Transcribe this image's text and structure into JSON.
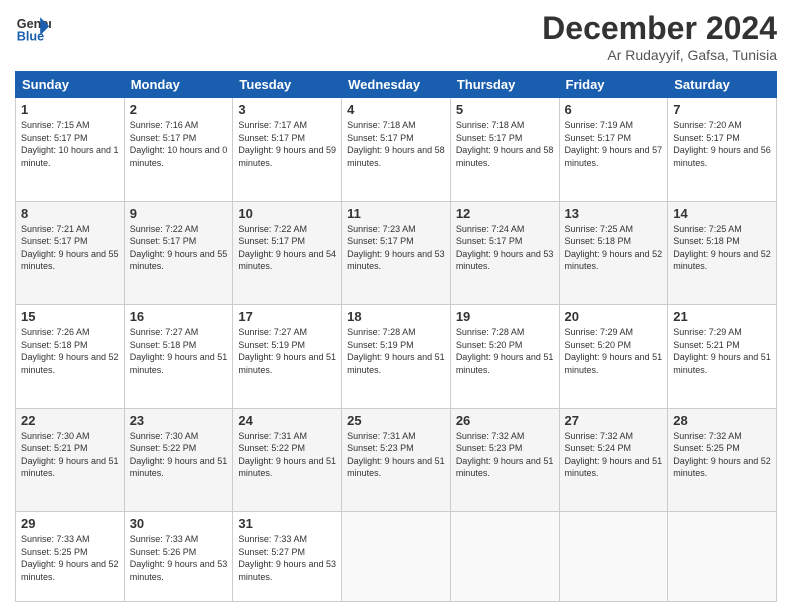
{
  "header": {
    "logo_general": "General",
    "logo_blue": "Blue",
    "month": "December 2024",
    "location": "Ar Rudayyif, Gafsa, Tunisia"
  },
  "weekdays": [
    "Sunday",
    "Monday",
    "Tuesday",
    "Wednesday",
    "Thursday",
    "Friday",
    "Saturday"
  ],
  "weeks": [
    [
      {
        "day": "1",
        "sunrise": "7:15 AM",
        "sunset": "5:17 PM",
        "daylight": "10 hours and 1 minute."
      },
      {
        "day": "2",
        "sunrise": "7:16 AM",
        "sunset": "5:17 PM",
        "daylight": "10 hours and 0 minutes."
      },
      {
        "day": "3",
        "sunrise": "7:17 AM",
        "sunset": "5:17 PM",
        "daylight": "9 hours and 59 minutes."
      },
      {
        "day": "4",
        "sunrise": "7:18 AM",
        "sunset": "5:17 PM",
        "daylight": "9 hours and 58 minutes."
      },
      {
        "day": "5",
        "sunrise": "7:18 AM",
        "sunset": "5:17 PM",
        "daylight": "9 hours and 58 minutes."
      },
      {
        "day": "6",
        "sunrise": "7:19 AM",
        "sunset": "5:17 PM",
        "daylight": "9 hours and 57 minutes."
      },
      {
        "day": "7",
        "sunrise": "7:20 AM",
        "sunset": "5:17 PM",
        "daylight": "9 hours and 56 minutes."
      }
    ],
    [
      {
        "day": "8",
        "sunrise": "7:21 AM",
        "sunset": "5:17 PM",
        "daylight": "9 hours and 55 minutes."
      },
      {
        "day": "9",
        "sunrise": "7:22 AM",
        "sunset": "5:17 PM",
        "daylight": "9 hours and 55 minutes."
      },
      {
        "day": "10",
        "sunrise": "7:22 AM",
        "sunset": "5:17 PM",
        "daylight": "9 hours and 54 minutes."
      },
      {
        "day": "11",
        "sunrise": "7:23 AM",
        "sunset": "5:17 PM",
        "daylight": "9 hours and 53 minutes."
      },
      {
        "day": "12",
        "sunrise": "7:24 AM",
        "sunset": "5:17 PM",
        "daylight": "9 hours and 53 minutes."
      },
      {
        "day": "13",
        "sunrise": "7:25 AM",
        "sunset": "5:18 PM",
        "daylight": "9 hours and 52 minutes."
      },
      {
        "day": "14",
        "sunrise": "7:25 AM",
        "sunset": "5:18 PM",
        "daylight": "9 hours and 52 minutes."
      }
    ],
    [
      {
        "day": "15",
        "sunrise": "7:26 AM",
        "sunset": "5:18 PM",
        "daylight": "9 hours and 52 minutes."
      },
      {
        "day": "16",
        "sunrise": "7:27 AM",
        "sunset": "5:18 PM",
        "daylight": "9 hours and 51 minutes."
      },
      {
        "day": "17",
        "sunrise": "7:27 AM",
        "sunset": "5:19 PM",
        "daylight": "9 hours and 51 minutes."
      },
      {
        "day": "18",
        "sunrise": "7:28 AM",
        "sunset": "5:19 PM",
        "daylight": "9 hours and 51 minutes."
      },
      {
        "day": "19",
        "sunrise": "7:28 AM",
        "sunset": "5:20 PM",
        "daylight": "9 hours and 51 minutes."
      },
      {
        "day": "20",
        "sunrise": "7:29 AM",
        "sunset": "5:20 PM",
        "daylight": "9 hours and 51 minutes."
      },
      {
        "day": "21",
        "sunrise": "7:29 AM",
        "sunset": "5:21 PM",
        "daylight": "9 hours and 51 minutes."
      }
    ],
    [
      {
        "day": "22",
        "sunrise": "7:30 AM",
        "sunset": "5:21 PM",
        "daylight": "9 hours and 51 minutes."
      },
      {
        "day": "23",
        "sunrise": "7:30 AM",
        "sunset": "5:22 PM",
        "daylight": "9 hours and 51 minutes."
      },
      {
        "day": "24",
        "sunrise": "7:31 AM",
        "sunset": "5:22 PM",
        "daylight": "9 hours and 51 minutes."
      },
      {
        "day": "25",
        "sunrise": "7:31 AM",
        "sunset": "5:23 PM",
        "daylight": "9 hours and 51 minutes."
      },
      {
        "day": "26",
        "sunrise": "7:32 AM",
        "sunset": "5:23 PM",
        "daylight": "9 hours and 51 minutes."
      },
      {
        "day": "27",
        "sunrise": "7:32 AM",
        "sunset": "5:24 PM",
        "daylight": "9 hours and 51 minutes."
      },
      {
        "day": "28",
        "sunrise": "7:32 AM",
        "sunset": "5:25 PM",
        "daylight": "9 hours and 52 minutes."
      }
    ],
    [
      {
        "day": "29",
        "sunrise": "7:33 AM",
        "sunset": "5:25 PM",
        "daylight": "9 hours and 52 minutes."
      },
      {
        "day": "30",
        "sunrise": "7:33 AM",
        "sunset": "5:26 PM",
        "daylight": "9 hours and 53 minutes."
      },
      {
        "day": "31",
        "sunrise": "7:33 AM",
        "sunset": "5:27 PM",
        "daylight": "9 hours and 53 minutes."
      },
      null,
      null,
      null,
      null
    ]
  ]
}
